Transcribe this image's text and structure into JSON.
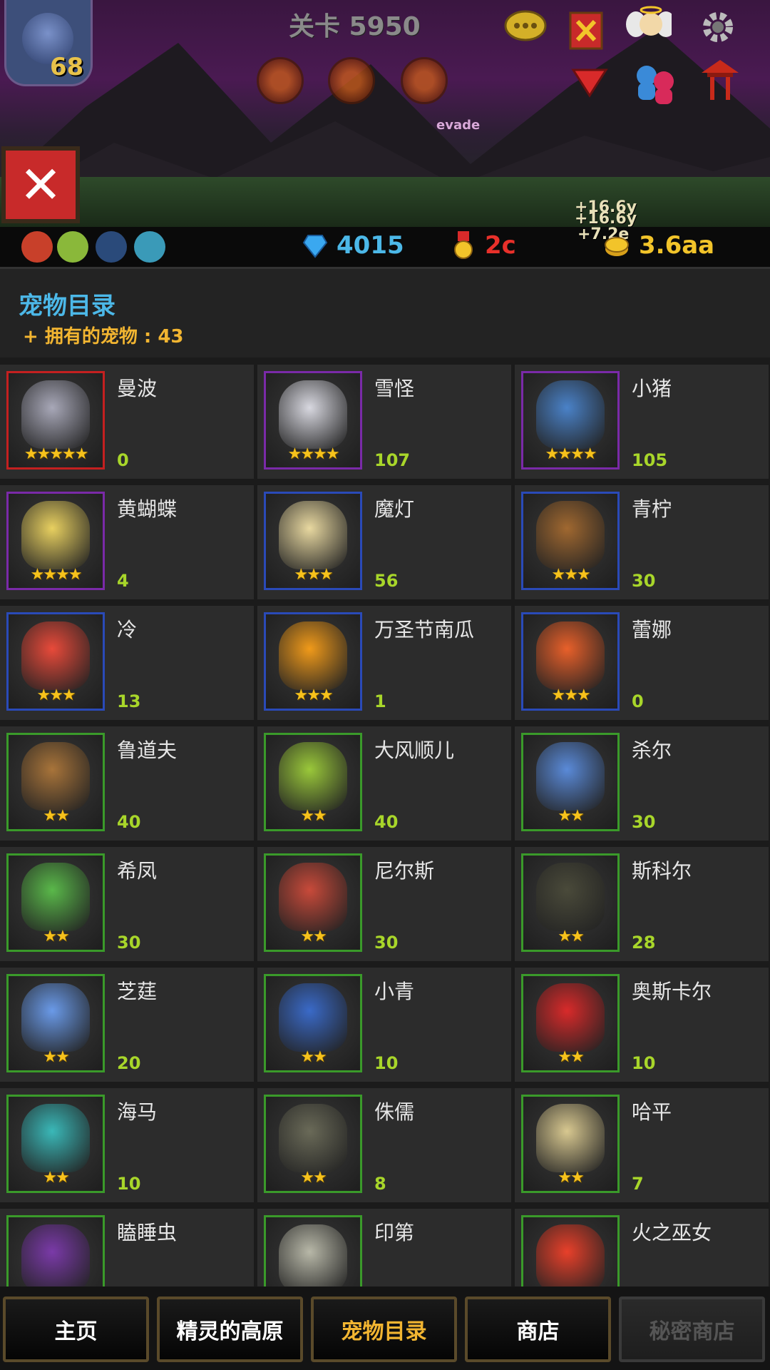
{
  "scene": {
    "stage_title": "关卡 5950",
    "player_level": "68",
    "evade_text": "evade",
    "float_texts": [
      "+16.6y",
      "+16.6y",
      "+7.2e"
    ]
  },
  "resources": {
    "gems": "4015",
    "medals": "2c",
    "gold": "3.6aa"
  },
  "panel": {
    "title": "宠物目录",
    "owned": "+ 拥有的宠物 : 43"
  },
  "pets": [
    {
      "name": "曼波",
      "count": "0",
      "stars": 5,
      "frame": "#c42020",
      "tint": "#a8a8b8"
    },
    {
      "name": "雪怪",
      "count": "107",
      "stars": 4,
      "frame": "#7a2aa8",
      "tint": "#d8d8e0"
    },
    {
      "name": "小猪",
      "count": "105",
      "stars": 4,
      "frame": "#7a2aa8",
      "tint": "#4a82c8"
    },
    {
      "name": "黄蝴蝶",
      "count": "4",
      "stars": 4,
      "frame": "#7a2aa8",
      "tint": "#e8d060"
    },
    {
      "name": "魔灯",
      "count": "56",
      "stars": 3,
      "frame": "#2a4ab8",
      "tint": "#e8d8a0"
    },
    {
      "name": "青柠",
      "count": "30",
      "stars": 3,
      "frame": "#2a4ab8",
      "tint": "#a06830"
    },
    {
      "name": "冷",
      "count": "13",
      "stars": 3,
      "frame": "#2a4ab8",
      "tint": "#e84a3a"
    },
    {
      "name": "万圣节南瓜",
      "count": "1",
      "stars": 3,
      "frame": "#2a4ab8",
      "tint": "#f09a1a"
    },
    {
      "name": "蕾娜",
      "count": "0",
      "stars": 3,
      "frame": "#2a4ab8",
      "tint": "#e8602a"
    },
    {
      "name": "鲁道夫",
      "count": "40",
      "stars": 2,
      "frame": "#3a9a2a",
      "tint": "#a8743a"
    },
    {
      "name": "大风顺儿",
      "count": "40",
      "stars": 2,
      "frame": "#3a9a2a",
      "tint": "#9ac83a"
    },
    {
      "name": "杀尔",
      "count": "30",
      "stars": 2,
      "frame": "#3a9a2a",
      "tint": "#5a8ad8"
    },
    {
      "name": "希凤",
      "count": "30",
      "stars": 2,
      "frame": "#3a9a2a",
      "tint": "#5ab84a"
    },
    {
      "name": "尼尔斯",
      "count": "30",
      "stars": 2,
      "frame": "#3a9a2a",
      "tint": "#c84a3a"
    },
    {
      "name": "斯科尔",
      "count": "28",
      "stars": 2,
      "frame": "#3a9a2a",
      "tint": "#4a4a3a"
    },
    {
      "name": "芝莛",
      "count": "20",
      "stars": 2,
      "frame": "#3a9a2a",
      "tint": "#6a9ae8"
    },
    {
      "name": "小青",
      "count": "10",
      "stars": 2,
      "frame": "#3a9a2a",
      "tint": "#3a6ac8"
    },
    {
      "name": "奥斯卡尔",
      "count": "10",
      "stars": 2,
      "frame": "#3a9a2a",
      "tint": "#d82a2a"
    },
    {
      "name": "海马",
      "count": "10",
      "stars": 2,
      "frame": "#3a9a2a",
      "tint": "#3ab8b8"
    },
    {
      "name": "侏儒",
      "count": "8",
      "stars": 2,
      "frame": "#3a9a2a",
      "tint": "#6a6a58"
    },
    {
      "name": "哈平",
      "count": "7",
      "stars": 2,
      "frame": "#3a9a2a",
      "tint": "#d8c890"
    },
    {
      "name": "瞌睡虫",
      "count": "",
      "stars": 0,
      "frame": "#3a9a2a",
      "tint": "#7a3aa8"
    },
    {
      "name": "印第",
      "count": "",
      "stars": 0,
      "frame": "#3a9a2a",
      "tint": "#b8b8a8"
    },
    {
      "name": "火之巫女",
      "count": "",
      "stars": 0,
      "frame": "#3a9a2a",
      "tint": "#e8402a"
    }
  ],
  "nav": [
    {
      "label": "主页"
    },
    {
      "label": "精灵的高原"
    },
    {
      "label": "宠物目录"
    },
    {
      "label": "商店"
    },
    {
      "label": "秘密商店"
    }
  ]
}
